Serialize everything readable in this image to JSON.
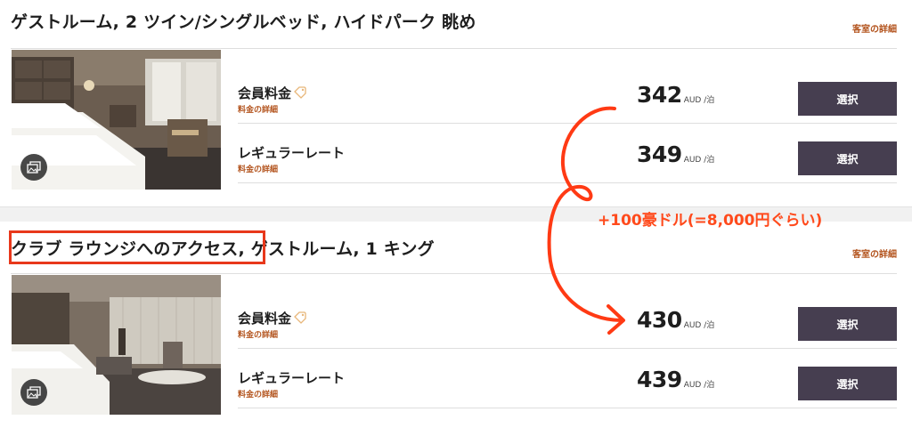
{
  "rooms": [
    {
      "title": "ゲストルーム, 2 ツイン/シングルベッド, ハイドパーク 眺め",
      "details_link": "客室の詳細",
      "rates": [
        {
          "name": "会員料金",
          "details": "料金の詳細",
          "amount": "342",
          "unit": "AUD /泊",
          "select_label": "選択",
          "member": true
        },
        {
          "name": "レギュラーレート",
          "details": "料金の詳細",
          "amount": "349",
          "unit": "AUD /泊",
          "select_label": "選択",
          "member": false
        }
      ]
    },
    {
      "title": "クラブ ラウンジへのアクセス, ゲストルーム, 1 キング",
      "details_link": "客室の詳細",
      "rates": [
        {
          "name": "会員料金",
          "details": "料金の詳細",
          "amount": "430",
          "unit": "AUD /泊",
          "select_label": "選択",
          "member": true
        },
        {
          "name": "レギュラーレート",
          "details": "料金の詳細",
          "amount": "439",
          "unit": "AUD /泊",
          "select_label": "選択",
          "member": false
        }
      ]
    }
  ],
  "annotation": {
    "text": "+100豪ドル(=8,000円ぐらい)",
    "color": "#ff4a1c"
  },
  "colors": {
    "accent_link": "#b3541e",
    "select_button": "#463e50",
    "annotation_red": "#e8381b"
  },
  "icons": {
    "gallery": "gallery-icon",
    "member_tag": "tag-icon"
  }
}
